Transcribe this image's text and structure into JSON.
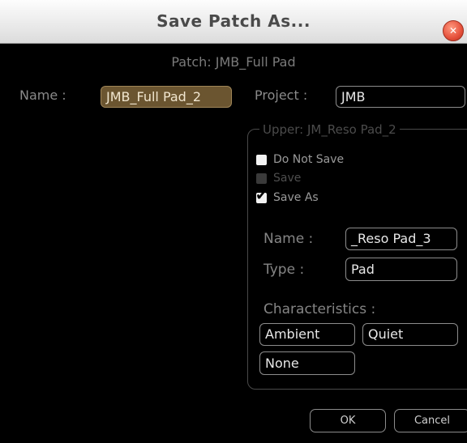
{
  "dialog": {
    "title": "Save Patch As...",
    "close_icon": "close-icon"
  },
  "patch": {
    "label": "Patch: JMB_Full Pad"
  },
  "name": {
    "label": "Name :",
    "value": "JMB_Full Pad_2"
  },
  "project": {
    "label": "Project :",
    "value": "JMB"
  },
  "upper": {
    "group_title": "Upper: JM_Reso Pad_2",
    "options": [
      {
        "label": "Do Not Save",
        "state": "unchecked"
      },
      {
        "label": "Save",
        "state": "disabled"
      },
      {
        "label": "Save As",
        "state": "checked"
      }
    ],
    "name_label": "Name :",
    "name_value": "_Reso Pad_3",
    "type_label": "Type :",
    "type_value": "Pad",
    "characteristics_label": "Characteristics :",
    "characteristics": [
      "Ambient",
      "Quiet",
      "None"
    ]
  },
  "buttons": {
    "ok": "OK",
    "cancel": "Cancel"
  },
  "colors": {
    "background": "#000000",
    "selection": "#6b5530",
    "title_bar": "#e8e8e8",
    "close_button": "#e5503b"
  }
}
